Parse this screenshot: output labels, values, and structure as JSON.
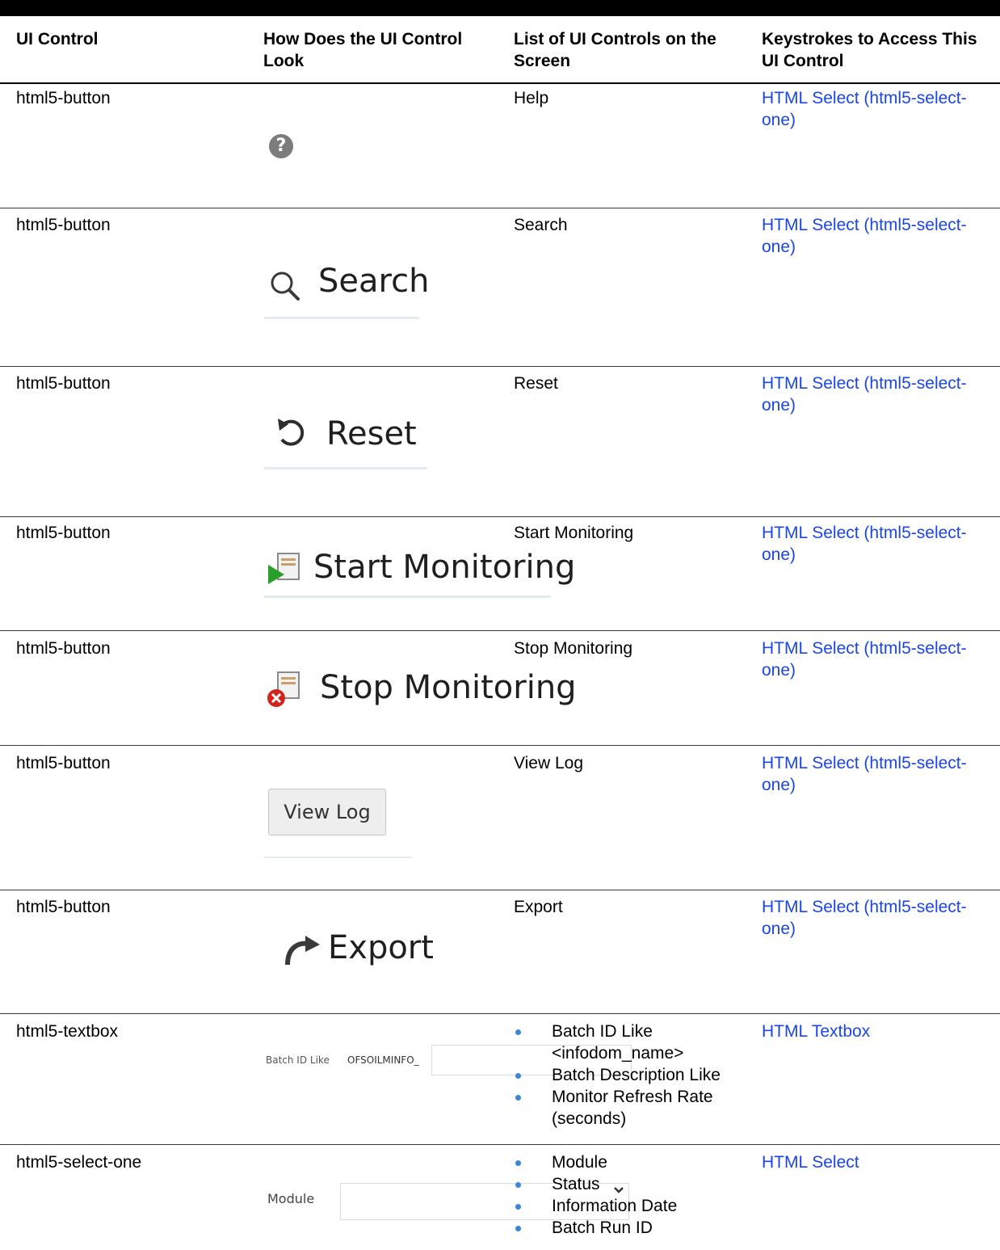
{
  "table": {
    "headers": [
      "UI Control",
      "How Does the UI Control Look",
      "List of UI Controls on the Screen",
      "Keystrokes to Access This UI Control"
    ],
    "rows": [
      {
        "control": "html5-button",
        "look": {
          "kind": "help-icon",
          "glyph": "?"
        },
        "list": "Help",
        "keys": "HTML Select (html5-select-one)"
      },
      {
        "control": "html5-button",
        "look": {
          "kind": "search-button",
          "label": "Search"
        },
        "list": "Search",
        "keys": "HTML Select (html5-select-one)"
      },
      {
        "control": "html5-button",
        "look": {
          "kind": "reset-button",
          "label": "Reset"
        },
        "list": "Reset",
        "keys": "HTML Select (html5-select-one)"
      },
      {
        "control": "html5-button",
        "look": {
          "kind": "start-monitoring-button",
          "label": "Start Monitoring"
        },
        "list": "Start Monitoring",
        "keys": "HTML Select (html5-select-one)"
      },
      {
        "control": "html5-button",
        "look": {
          "kind": "stop-monitoring-button",
          "label": "Stop Monitoring"
        },
        "list": "Stop Monitoring",
        "keys": "HTML Select (html5-select-one)"
      },
      {
        "control": "html5-button",
        "look": {
          "kind": "view-log-button",
          "label": "View Log"
        },
        "list": "View Log",
        "keys": "HTML Select (html5-select-one)"
      },
      {
        "control": "html5-button",
        "look": {
          "kind": "export-button",
          "label": "Export"
        },
        "list": "Export",
        "keys": "HTML Select (html5-select-one)"
      },
      {
        "control": "html5-textbox",
        "look": {
          "kind": "textbox",
          "label": "Batch ID Like",
          "value": "OFSOILMINFO_"
        },
        "list_items": [
          "Batch ID Like <infodom_name>",
          "Batch Description Like",
          "Monitor Refresh Rate (seconds)"
        ],
        "keys": "HTML Textbox"
      },
      {
        "control": "html5-select-one",
        "look": {
          "kind": "select",
          "label": "Module"
        },
        "list_items": [
          "Module",
          "Status",
          "Information Date",
          "Batch Run ID"
        ],
        "keys": "HTML Select"
      }
    ]
  },
  "colors": {
    "link": "#1a46e8",
    "bullet": "#3a86d8",
    "rule": "#000000"
  }
}
